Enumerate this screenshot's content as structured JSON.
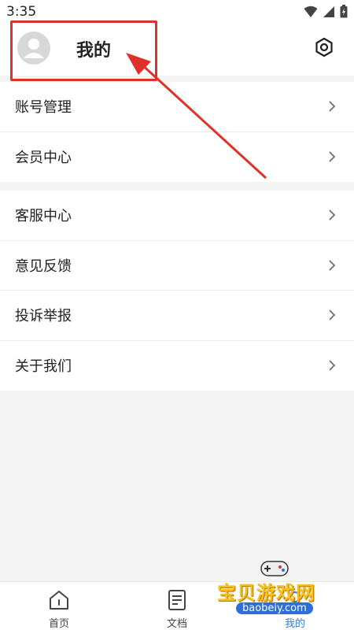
{
  "status_bar": {
    "time": "3:35"
  },
  "header": {
    "title": "我的",
    "settings_icon": "gear-icon",
    "avatar_icon": "user-avatar"
  },
  "groups": [
    {
      "items": [
        {
          "label": "账号管理"
        },
        {
          "label": "会员中心"
        }
      ]
    },
    {
      "items": [
        {
          "label": "客服中心"
        },
        {
          "label": "意见反馈"
        },
        {
          "label": "投诉举报"
        },
        {
          "label": "关于我们"
        }
      ]
    }
  ],
  "tabbar": {
    "items": [
      {
        "label": "首页",
        "icon": "home-icon"
      },
      {
        "label": "文档",
        "icon": "document-icon"
      },
      {
        "label": "我的",
        "icon": "user-icon"
      }
    ]
  },
  "watermark": {
    "text": "宝贝游戏网",
    "domain": "baobeiy.com"
  },
  "colors": {
    "accent": "#2d7fe0",
    "annotation": "#e0302a",
    "background": "#f4f4f4"
  }
}
